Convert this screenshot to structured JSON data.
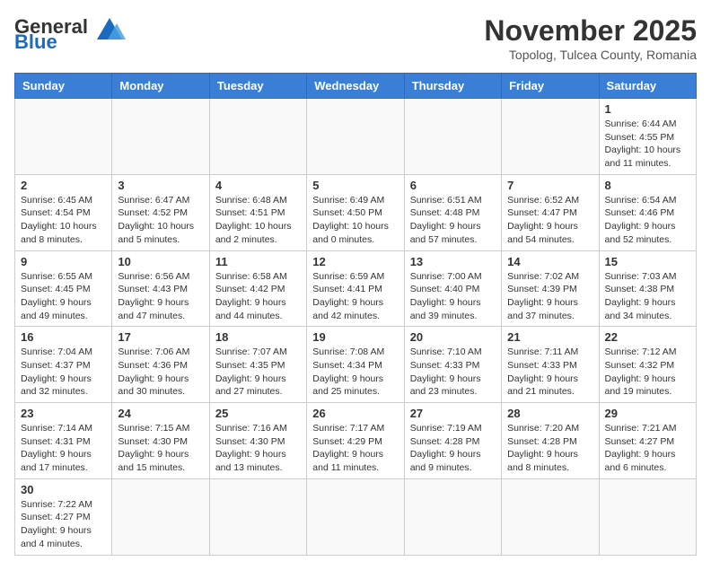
{
  "logo": {
    "brand": "General",
    "brand2": "Blue"
  },
  "header": {
    "month_year": "November 2025",
    "location": "Topolog, Tulcea County, Romania"
  },
  "weekdays": [
    "Sunday",
    "Monday",
    "Tuesday",
    "Wednesday",
    "Thursday",
    "Friday",
    "Saturday"
  ],
  "weeks": [
    [
      {
        "day": "",
        "info": ""
      },
      {
        "day": "",
        "info": ""
      },
      {
        "day": "",
        "info": ""
      },
      {
        "day": "",
        "info": ""
      },
      {
        "day": "",
        "info": ""
      },
      {
        "day": "",
        "info": ""
      },
      {
        "day": "1",
        "info": "Sunrise: 6:44 AM\nSunset: 4:55 PM\nDaylight: 10 hours and 11 minutes."
      }
    ],
    [
      {
        "day": "2",
        "info": "Sunrise: 6:45 AM\nSunset: 4:54 PM\nDaylight: 10 hours and 8 minutes."
      },
      {
        "day": "3",
        "info": "Sunrise: 6:47 AM\nSunset: 4:52 PM\nDaylight: 10 hours and 5 minutes."
      },
      {
        "day": "4",
        "info": "Sunrise: 6:48 AM\nSunset: 4:51 PM\nDaylight: 10 hours and 2 minutes."
      },
      {
        "day": "5",
        "info": "Sunrise: 6:49 AM\nSunset: 4:50 PM\nDaylight: 10 hours and 0 minutes."
      },
      {
        "day": "6",
        "info": "Sunrise: 6:51 AM\nSunset: 4:48 PM\nDaylight: 9 hours and 57 minutes."
      },
      {
        "day": "7",
        "info": "Sunrise: 6:52 AM\nSunset: 4:47 PM\nDaylight: 9 hours and 54 minutes."
      },
      {
        "day": "8",
        "info": "Sunrise: 6:54 AM\nSunset: 4:46 PM\nDaylight: 9 hours and 52 minutes."
      }
    ],
    [
      {
        "day": "9",
        "info": "Sunrise: 6:55 AM\nSunset: 4:45 PM\nDaylight: 9 hours and 49 minutes."
      },
      {
        "day": "10",
        "info": "Sunrise: 6:56 AM\nSunset: 4:43 PM\nDaylight: 9 hours and 47 minutes."
      },
      {
        "day": "11",
        "info": "Sunrise: 6:58 AM\nSunset: 4:42 PM\nDaylight: 9 hours and 44 minutes."
      },
      {
        "day": "12",
        "info": "Sunrise: 6:59 AM\nSunset: 4:41 PM\nDaylight: 9 hours and 42 minutes."
      },
      {
        "day": "13",
        "info": "Sunrise: 7:00 AM\nSunset: 4:40 PM\nDaylight: 9 hours and 39 minutes."
      },
      {
        "day": "14",
        "info": "Sunrise: 7:02 AM\nSunset: 4:39 PM\nDaylight: 9 hours and 37 minutes."
      },
      {
        "day": "15",
        "info": "Sunrise: 7:03 AM\nSunset: 4:38 PM\nDaylight: 9 hours and 34 minutes."
      }
    ],
    [
      {
        "day": "16",
        "info": "Sunrise: 7:04 AM\nSunset: 4:37 PM\nDaylight: 9 hours and 32 minutes."
      },
      {
        "day": "17",
        "info": "Sunrise: 7:06 AM\nSunset: 4:36 PM\nDaylight: 9 hours and 30 minutes."
      },
      {
        "day": "18",
        "info": "Sunrise: 7:07 AM\nSunset: 4:35 PM\nDaylight: 9 hours and 27 minutes."
      },
      {
        "day": "19",
        "info": "Sunrise: 7:08 AM\nSunset: 4:34 PM\nDaylight: 9 hours and 25 minutes."
      },
      {
        "day": "20",
        "info": "Sunrise: 7:10 AM\nSunset: 4:33 PM\nDaylight: 9 hours and 23 minutes."
      },
      {
        "day": "21",
        "info": "Sunrise: 7:11 AM\nSunset: 4:33 PM\nDaylight: 9 hours and 21 minutes."
      },
      {
        "day": "22",
        "info": "Sunrise: 7:12 AM\nSunset: 4:32 PM\nDaylight: 9 hours and 19 minutes."
      }
    ],
    [
      {
        "day": "23",
        "info": "Sunrise: 7:14 AM\nSunset: 4:31 PM\nDaylight: 9 hours and 17 minutes."
      },
      {
        "day": "24",
        "info": "Sunrise: 7:15 AM\nSunset: 4:30 PM\nDaylight: 9 hours and 15 minutes."
      },
      {
        "day": "25",
        "info": "Sunrise: 7:16 AM\nSunset: 4:30 PM\nDaylight: 9 hours and 13 minutes."
      },
      {
        "day": "26",
        "info": "Sunrise: 7:17 AM\nSunset: 4:29 PM\nDaylight: 9 hours and 11 minutes."
      },
      {
        "day": "27",
        "info": "Sunrise: 7:19 AM\nSunset: 4:28 PM\nDaylight: 9 hours and 9 minutes."
      },
      {
        "day": "28",
        "info": "Sunrise: 7:20 AM\nSunset: 4:28 PM\nDaylight: 9 hours and 8 minutes."
      },
      {
        "day": "29",
        "info": "Sunrise: 7:21 AM\nSunset: 4:27 PM\nDaylight: 9 hours and 6 minutes."
      }
    ],
    [
      {
        "day": "30",
        "info": "Sunrise: 7:22 AM\nSunset: 4:27 PM\nDaylight: 9 hours and 4 minutes."
      },
      {
        "day": "",
        "info": ""
      },
      {
        "day": "",
        "info": ""
      },
      {
        "day": "",
        "info": ""
      },
      {
        "day": "",
        "info": ""
      },
      {
        "day": "",
        "info": ""
      },
      {
        "day": "",
        "info": ""
      }
    ]
  ]
}
